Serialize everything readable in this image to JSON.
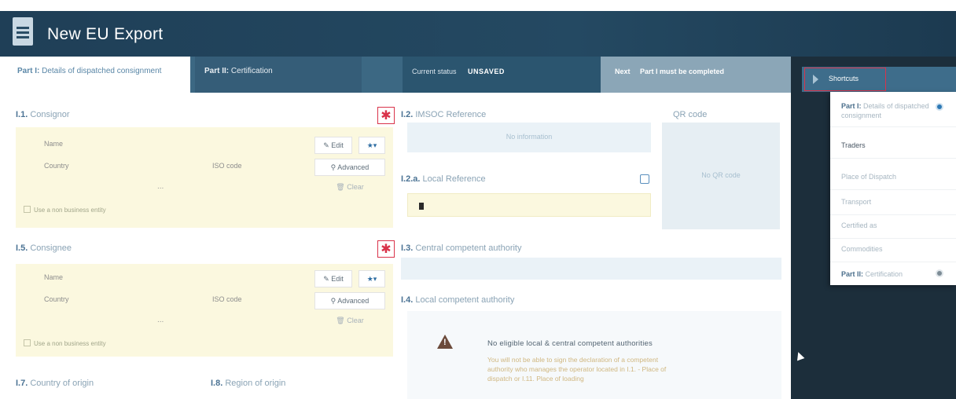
{
  "header": {
    "title": "New EU Export"
  },
  "tabs": {
    "part1": {
      "prefix": "Part I:",
      "label": "Details of dispatched consignment"
    },
    "part2": {
      "prefix": "Part II:",
      "label": "Certification"
    }
  },
  "status": {
    "label": "Current status",
    "value": "UNSAVED"
  },
  "next": {
    "label": "Next",
    "value": "Part I must be completed"
  },
  "consignor": {
    "num": "I.1.",
    "title": "Consignor",
    "name_label": "Name",
    "country_label": "Country",
    "iso_label": "ISO code",
    "dots": "...",
    "checkbox": "Use a non business entity",
    "edit": "Edit",
    "advanced": "Advanced",
    "clear": "Clear",
    "star": "★▾"
  },
  "consignee": {
    "num": "I.5.",
    "title": "Consignee",
    "name_label": "Name",
    "country_label": "Country",
    "iso_label": "ISO code",
    "dots": "...",
    "checkbox": "Use a non business entity",
    "edit": "Edit",
    "advanced": "Advanced",
    "clear": "Clear",
    "star": "★▾"
  },
  "country_origin": {
    "num": "I.7.",
    "title": "Country of origin"
  },
  "region_origin": {
    "num": "I.8.",
    "title": "Region of origin"
  },
  "imsoc": {
    "num": "I.2.",
    "title": "IMSOC Reference",
    "value": "No information"
  },
  "qr": {
    "title": "QR code",
    "value": "No QR code"
  },
  "local_ref": {
    "num": "I.2.a.",
    "title": "Local Reference"
  },
  "central_authority": {
    "num": "I.3.",
    "title": "Central competent authority"
  },
  "local_authority": {
    "num": "I.4.",
    "title": "Local competent authority"
  },
  "warning": {
    "heading": "No eligible local & central competent authorities",
    "body_lines": [
      "You will not be able to sign the declaration of a competent",
      "authority who manages the operator located in I.1. - Place of",
      "dispatch or I.11. Place of loading"
    ]
  },
  "shortcuts": {
    "button": "Shortcuts",
    "items": [
      {
        "prefix": "Part I:",
        "label": "Details of dispatched consignment",
        "status": "blue"
      },
      {
        "prefix": "",
        "label": "Traders",
        "status": ""
      },
      {
        "prefix": "",
        "label": "Place of Dispatch",
        "status": ""
      },
      {
        "prefix": "",
        "label": "Transport",
        "status": ""
      },
      {
        "prefix": "",
        "label": "Certified as",
        "status": ""
      },
      {
        "prefix": "",
        "label": "Commodities",
        "status": ""
      },
      {
        "prefix": "Part II:",
        "label": "Certification",
        "status": "grey"
      }
    ]
  },
  "colors": {
    "header": "#1f3f57",
    "accent": "#3e6d8b",
    "required": "#d9334a",
    "party_bg": "#fbf8df"
  }
}
